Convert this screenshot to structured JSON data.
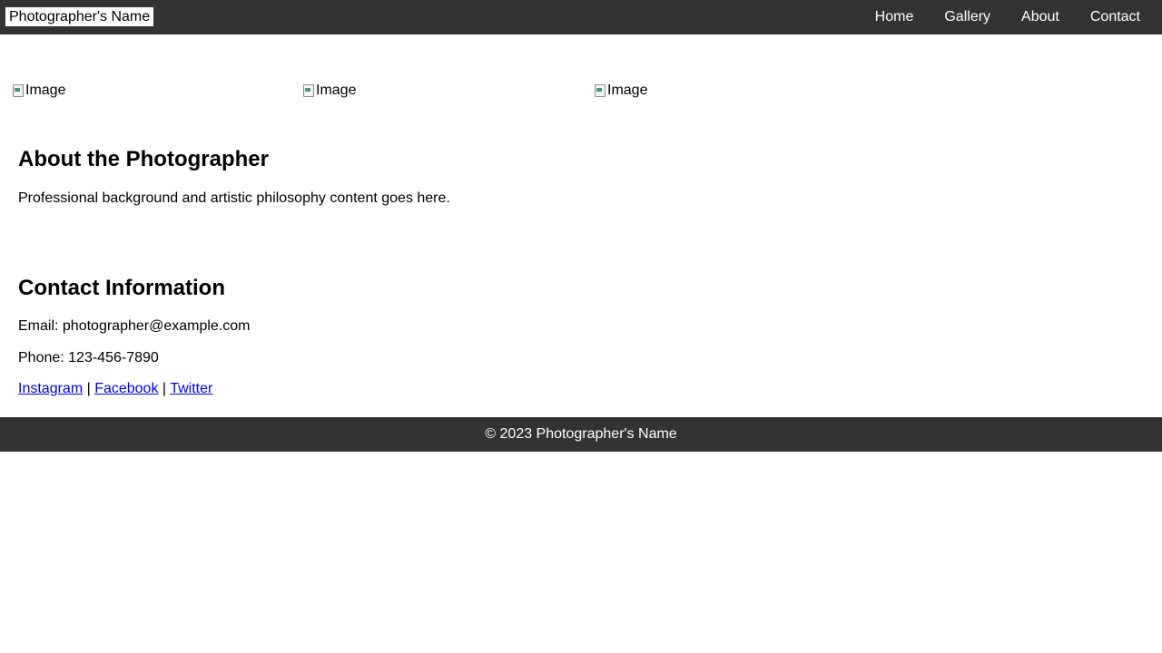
{
  "header": {
    "site_name": "Photographer's Name",
    "nav": [
      "Home",
      "Gallery",
      "About",
      "Contact"
    ]
  },
  "gallery": {
    "images": [
      {
        "alt": "Image"
      },
      {
        "alt": "Image"
      },
      {
        "alt": "Image"
      }
    ]
  },
  "about": {
    "heading": "About the Photographer",
    "text": "Professional background and artistic philosophy content goes here."
  },
  "contact": {
    "heading": "Contact Information",
    "email": "Email: photographer@example.com",
    "phone": "Phone: 123-456-7890",
    "social": [
      "Instagram",
      "Facebook",
      "Twitter"
    ],
    "separator": " | "
  },
  "footer": {
    "text": "© 2023 Photographer's Name"
  },
  "colors": {
    "bar_background": "#333333",
    "link": "#0000ee"
  },
  "icons": {
    "gallery_image": "broken-image-icon"
  }
}
